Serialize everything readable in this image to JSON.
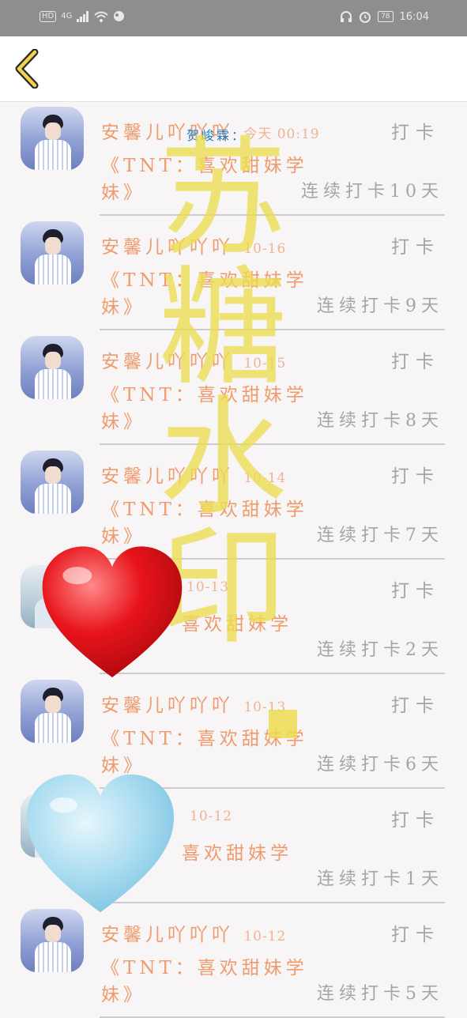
{
  "status_bar": {
    "hd": "HD",
    "network": "4G",
    "battery": "78",
    "time": "16:04"
  },
  "header": {
    "back_icon": "chevron-left-icon"
  },
  "list": {
    "rows": [
      {
        "name": "安馨儿吖吖吖",
        "date": "今天 00:19",
        "action": "打卡",
        "book_line1": "《TNT：喜欢甜妹学",
        "book_line2": "妹》",
        "streak": "连续打卡10天"
      },
      {
        "name": "安馨儿吖吖吖",
        "date": "10-16",
        "action": "打卡",
        "book_line1": "《TNT：喜欢甜妹学",
        "book_line2": "妹》",
        "streak": "连续打卡9天"
      },
      {
        "name": "安馨儿吖吖吖",
        "date": "10-15",
        "action": "打卡",
        "book_line1": "《TNT：喜欢甜妹学",
        "book_line2": "妹》",
        "streak": "连续打卡8天"
      },
      {
        "name": "安馨儿吖吖吖",
        "date": "10-14",
        "action": "打卡",
        "book_line1": "《TNT：喜欢甜妹学",
        "book_line2": "妹》",
        "streak": "连续打卡7天"
      },
      {
        "name": "",
        "date": "10-13",
        "action": "打卡",
        "book_line1": "喜欢甜妹学",
        "book_line2": "",
        "streak": "连续打卡2天"
      },
      {
        "name": "安馨儿吖吖吖",
        "date": "10-13",
        "action": "打卡",
        "book_line1": "《TNT：喜欢甜妹学",
        "book_line2": "妹》",
        "streak": "连续打卡6天"
      },
      {
        "name": "",
        "date": "10-12",
        "action": "打卡",
        "book_line1": "喜欢甜妹学",
        "book_line2": "",
        "streak": "连续打卡1天"
      },
      {
        "name": "安馨儿吖吖吖",
        "date": "10-12",
        "action": "打卡",
        "book_line1": "《TNT：喜欢甜妹学",
        "book_line2": "妹》",
        "streak": "连续打卡5天"
      }
    ]
  },
  "overlay": {
    "blue_text": "贺峻霖：",
    "watermark": [
      "苏",
      "糖",
      "水",
      "印"
    ]
  },
  "colors": {
    "accent": "#ef9b6d",
    "muted": "#a7a4a5",
    "watermark": "#ecdc50",
    "status_bar": "#8e8e8e"
  }
}
